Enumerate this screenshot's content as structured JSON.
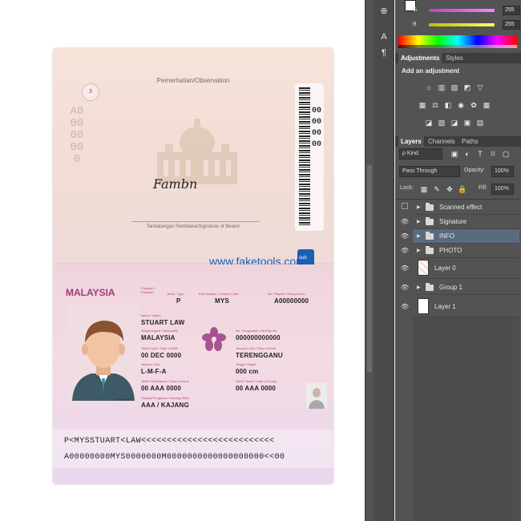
{
  "passport": {
    "observation_label": "Pemerhatian/Observation",
    "page_number": "3",
    "serial_left": "A00000000",
    "serial_right": "00000000",
    "signature_text": "Fambn",
    "signature_caption": "Tandatangan Pembawa/Signature of Bearer",
    "watermark": "www.faketools.com",
    "country": "MALAYSIA",
    "labels": {
      "passport": "Passport / Passport",
      "type": "Jenis / Type",
      "country_code": "Kod Negara / Country Code",
      "passport_no": "No. Pasport / Passport No.",
      "name": "Nama / Name",
      "nationality": "Warganegara / Nationality",
      "identity_no": "No. Pengenalan / Identity No.",
      "dob": "Tarikh Lahir / Date of Birth",
      "pob": "Tempat Lahir / Place of Birth",
      "sex": "Jantina / Sex",
      "height": "Tinggi / Height",
      "doi": "Tarikh Dikeluarkan / Date of Issue",
      "doe": "Tarikh Tamat / Date of Expiry",
      "office": "Pejabat Pengeluar / Issuing Office"
    },
    "values": {
      "type": "P",
      "country_code": "MYS",
      "passport_no": "A00000000",
      "name": "STUART LAW",
      "nationality": "MALAYSIA",
      "identity_no": "000000000000",
      "dob": "00 DEC 0000",
      "pob": "TERENGGANU",
      "sex": "L-M-F-A",
      "height": "000 cm",
      "doi": "00 AAA 0000",
      "doe": "00 AAA 0000",
      "office": "AAA / KAJANG",
      "photo_number": "00000000"
    },
    "mrz_line1": "P<MYSSTUART<LAW<<<<<<<<<<<<<<<<<<<<<<<<<<",
    "mrz_line2": "A00000000MYS0000000M0000000000000000000<<00"
  },
  "photoshop": {
    "color": {
      "g_label": "G",
      "g_value": "255",
      "b_label": "B",
      "b_value": "255",
      "g_color": "#c040c0",
      "b_color": "#d8d800"
    },
    "tabs_top": {
      "adjustments": "Adjustments",
      "styles": "Styles"
    },
    "add_adjustment": "Add an adjustment",
    "tabs_layers": {
      "layers": "Layers",
      "channels": "Channels",
      "paths": "Paths"
    },
    "kind_label": "ρ Kind",
    "blend_mode": "Pass Through",
    "opacity_label": "Opacity:",
    "opacity_value": "100%",
    "lock_label": "Lock:",
    "fill_label": "Fill:",
    "fill_value": "100%",
    "layers": [
      {
        "name": "Scanned effect",
        "type": "folder",
        "visible": false
      },
      {
        "name": "Signature",
        "type": "folder",
        "visible": true
      },
      {
        "name": "INFO",
        "type": "folder",
        "visible": true,
        "selected": true
      },
      {
        "name": "PHOTO",
        "type": "folder",
        "visible": true
      },
      {
        "name": "Layer 0",
        "type": "layer",
        "visible": true
      },
      {
        "name": "Group 1",
        "type": "folder",
        "visible": true
      },
      {
        "name": "Layer 1",
        "type": "layer",
        "visible": true
      }
    ],
    "selection_color": "#5a6b7f"
  }
}
